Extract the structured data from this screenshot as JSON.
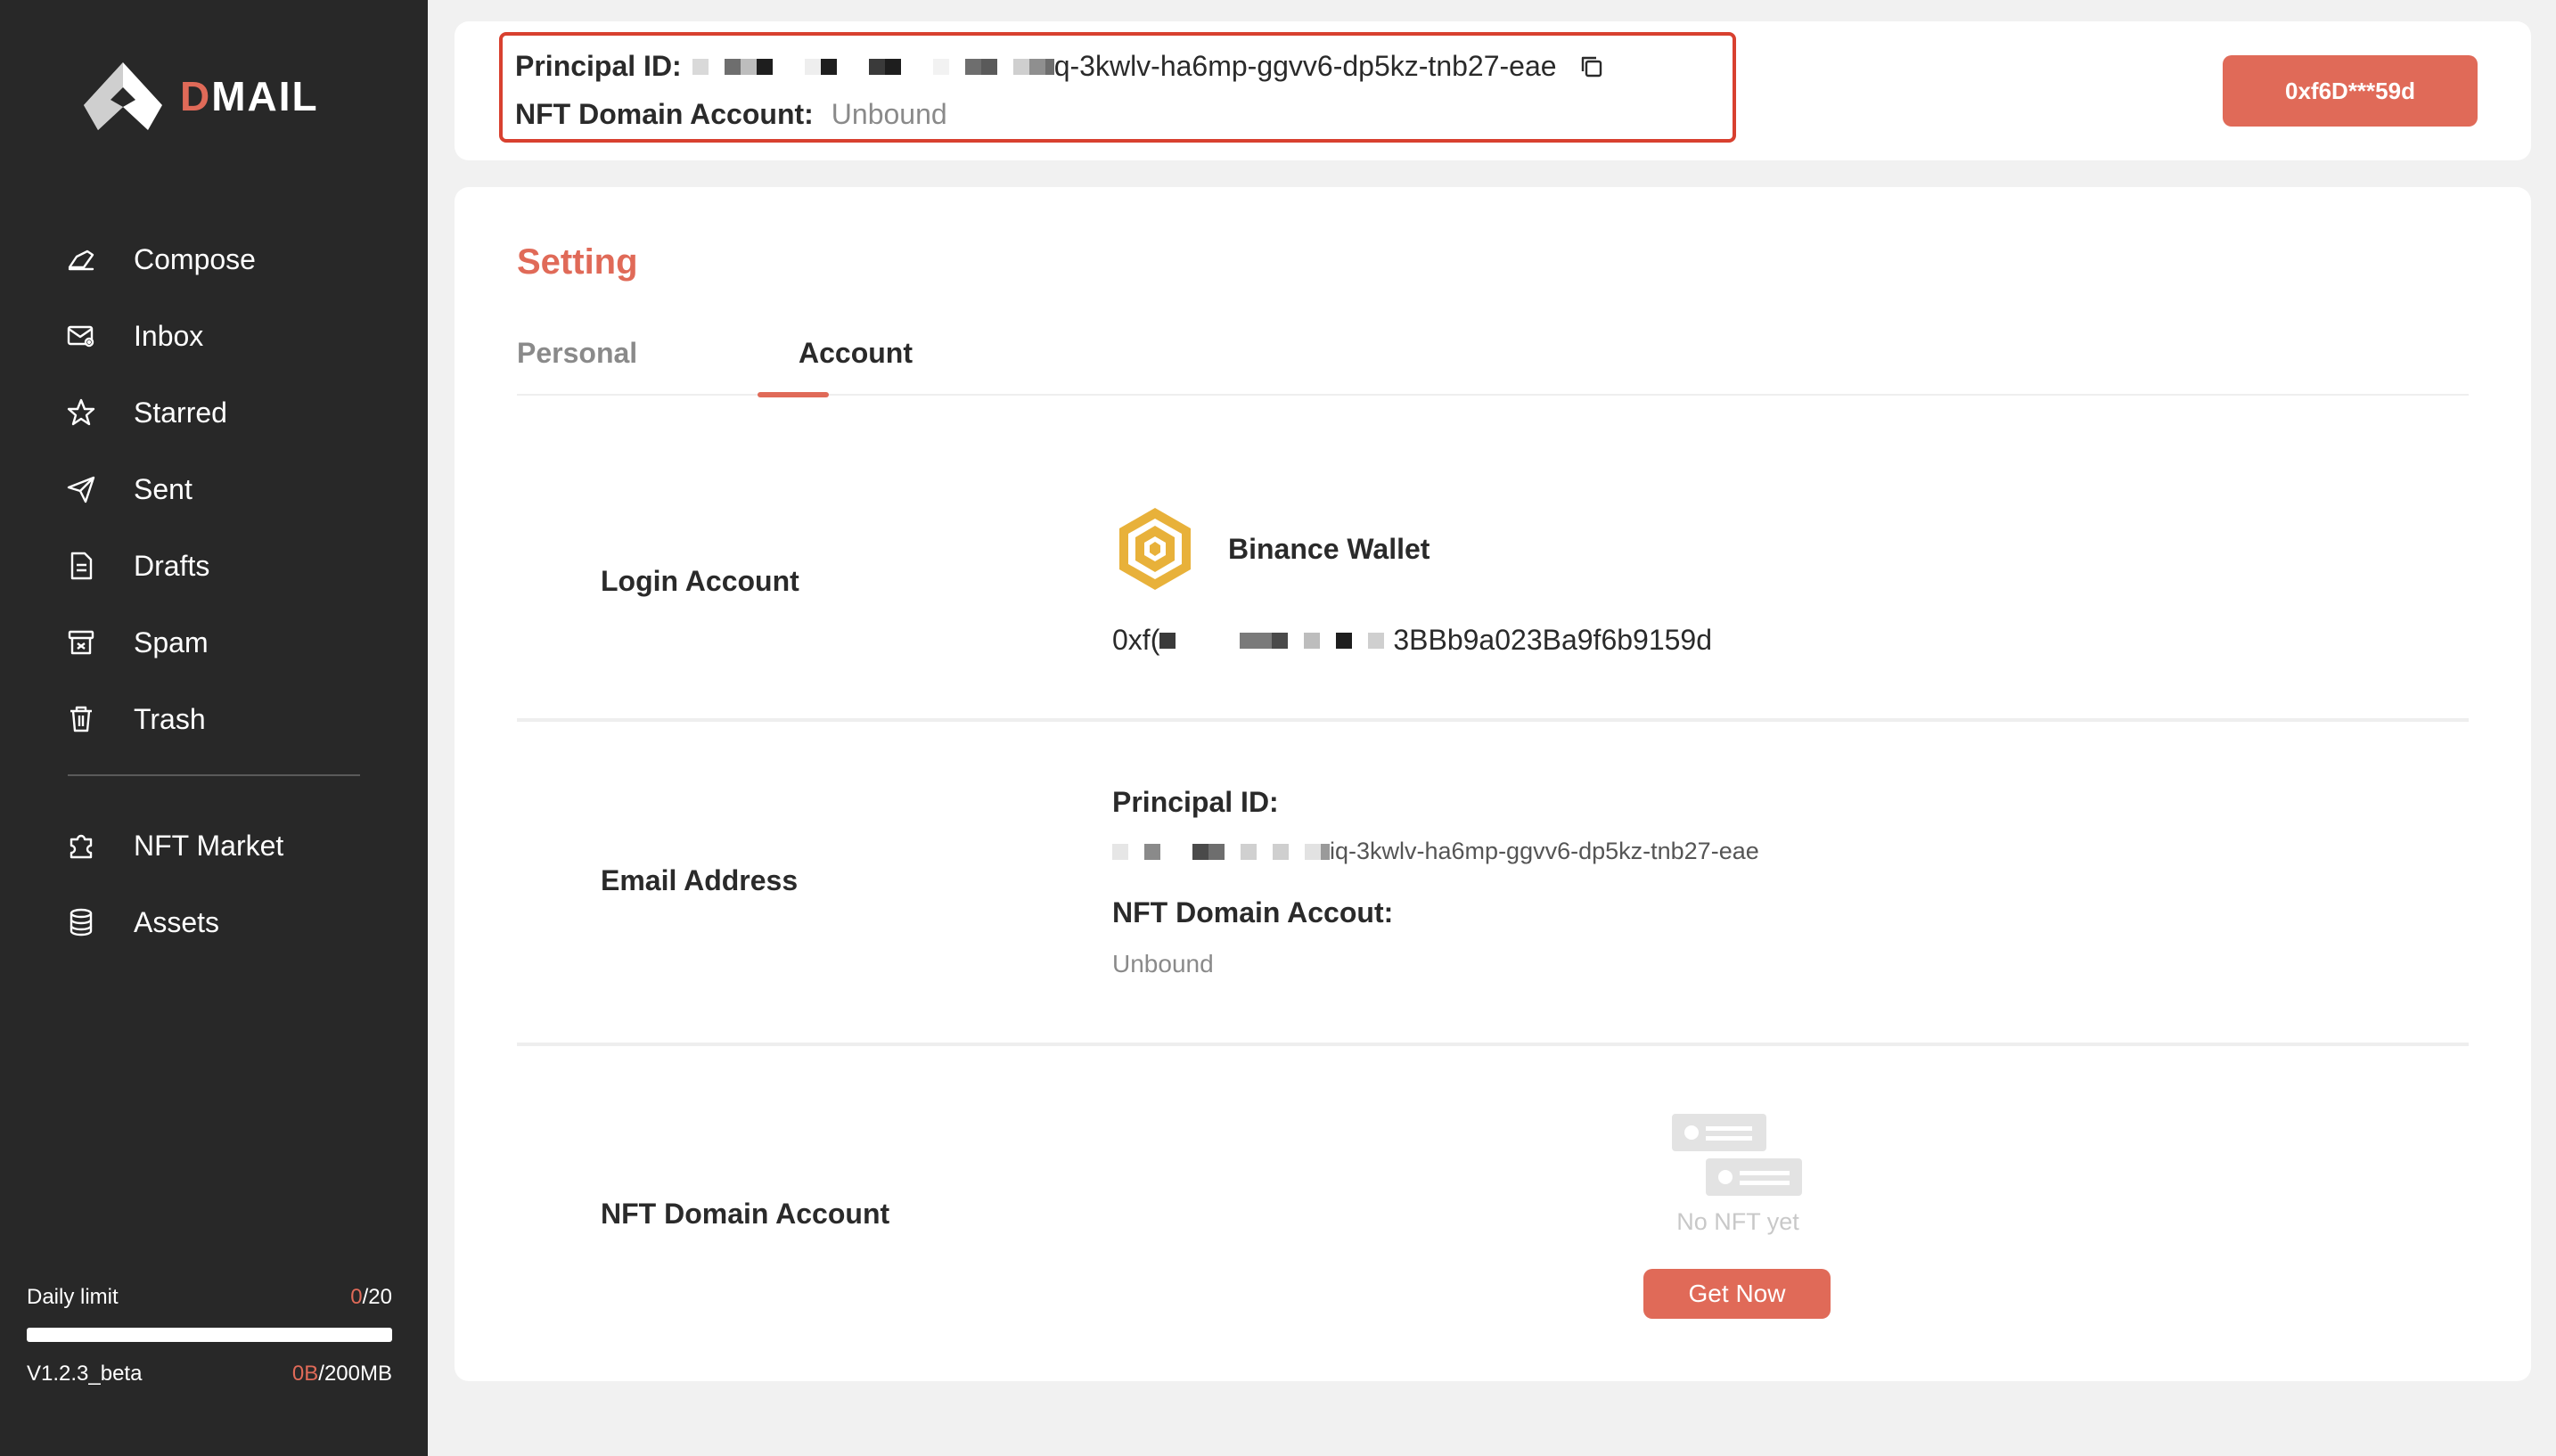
{
  "brand": {
    "name_prefix": "D",
    "name_rest": "MAIL"
  },
  "nav": {
    "primary": [
      {
        "label": "Compose",
        "icon": "compose-icon"
      },
      {
        "label": "Inbox",
        "icon": "inbox-icon"
      },
      {
        "label": "Starred",
        "icon": "star-icon"
      },
      {
        "label": "Sent",
        "icon": "send-icon"
      },
      {
        "label": "Drafts",
        "icon": "draft-icon"
      },
      {
        "label": "Spam",
        "icon": "spam-icon"
      },
      {
        "label": "Trash",
        "icon": "trash-icon"
      }
    ],
    "secondary": [
      {
        "label": "NFT Market",
        "icon": "puzzle-icon"
      },
      {
        "label": "Assets",
        "icon": "database-icon"
      }
    ]
  },
  "limits": {
    "daily_label": "Daily limit",
    "daily_used": "0",
    "daily_total": "/20",
    "daily_fraction": 0,
    "version": "V1.2.3_beta",
    "storage_used": "0B",
    "storage_total": "/200MB"
  },
  "header": {
    "principal_label": "Principal ID:",
    "principal_visible": "q-3kwlv-ha6mp-ggvv6-dp5kz-tnb27-eae",
    "nft_label": "NFT Domain Account:",
    "nft_value": "Unbound",
    "wallet_button": "0xf6D***59d"
  },
  "settings": {
    "title": "Setting",
    "tabs": [
      "Personal",
      "Account"
    ],
    "active_tab": "Account",
    "login": {
      "label": "Login Account",
      "wallet_name": "Binance Wallet",
      "address_start": "0xf(",
      "address_end": "3BBb9a023Ba9f6b9159d"
    },
    "email": {
      "label": "Email Address",
      "principal_label": "Principal ID:",
      "principal_visible": "iq-3kwlv-ha6mp-ggvv6-dp5kz-tnb27-eae",
      "nft_label": "NFT Domain Accout:",
      "nft_value": "Unbound"
    },
    "nft": {
      "label": "NFT Domain Account",
      "empty_text": "No NFT yet",
      "button": "Get Now"
    }
  },
  "colors": {
    "accent": "#e06a58",
    "sidebar": "#282828",
    "highlight_border": "#d8402f",
    "binance": "#e8b13a"
  }
}
